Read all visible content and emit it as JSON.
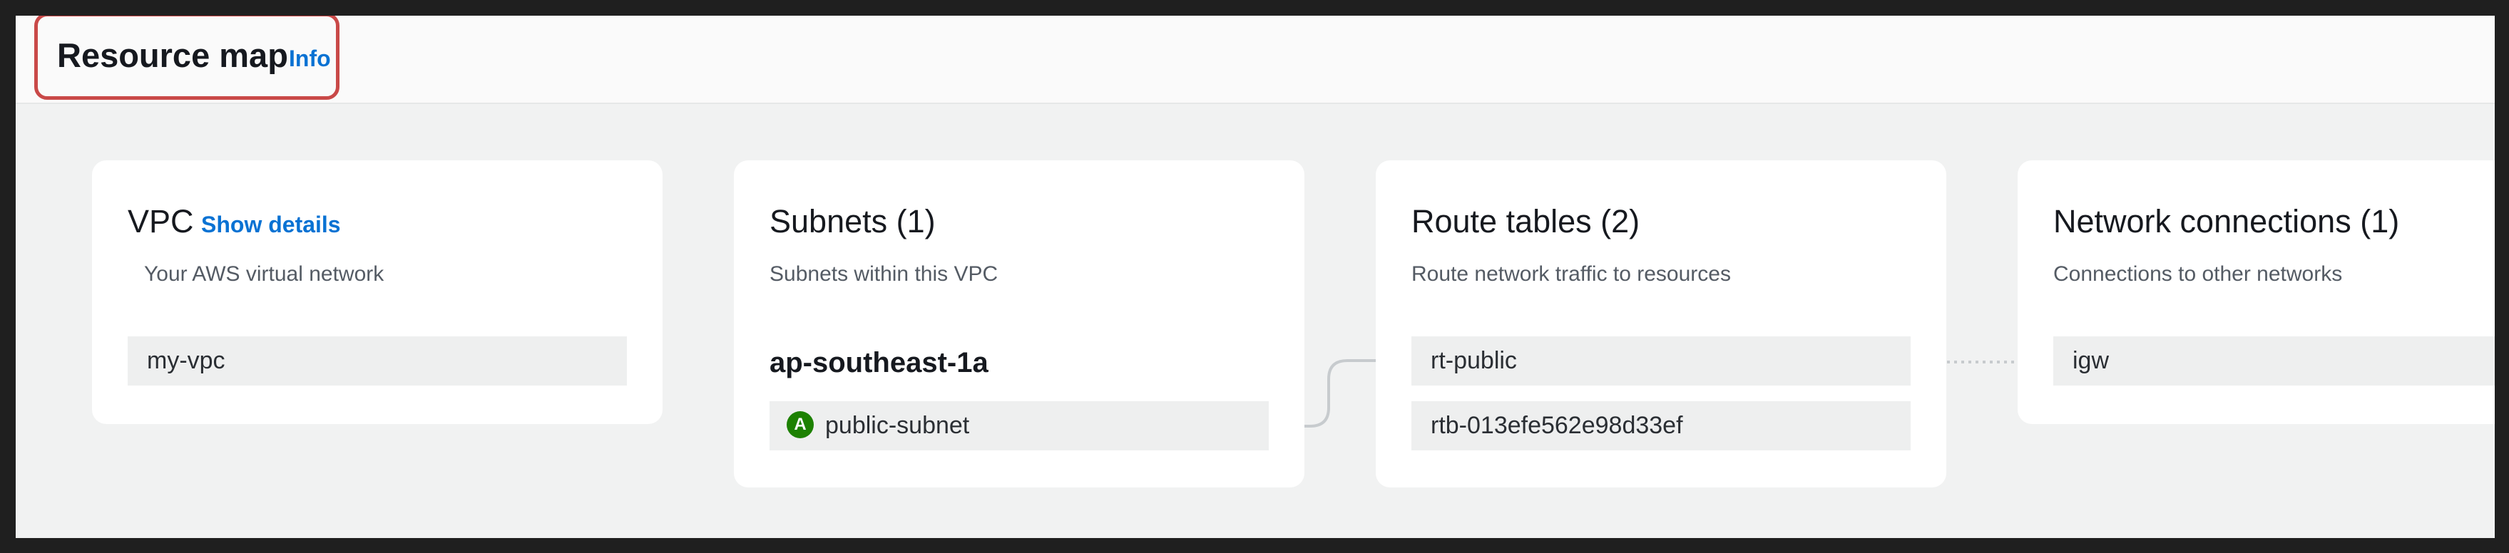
{
  "header": {
    "title": "Resource map",
    "info_link": "Info"
  },
  "vpc": {
    "title": "VPC",
    "show_details_link": "Show details",
    "subtitle": "Your AWS virtual network",
    "items": [
      "my-vpc"
    ]
  },
  "subnets": {
    "title": "Subnets (1)",
    "subtitle": "Subnets within this VPC",
    "availability_zone": "ap-southeast-1a",
    "items": [
      {
        "status_letter": "A",
        "name": "public-subnet"
      }
    ]
  },
  "route_tables": {
    "title": "Route tables (2)",
    "subtitle": "Route network traffic to resources",
    "items": [
      "rt-public",
      "rtb-013efe562e98d33ef"
    ]
  },
  "network_connections": {
    "title": "Network connections (1)",
    "subtitle": "Connections to other networks",
    "items": [
      "igw"
    ]
  },
  "colors": {
    "accent_link": "#0972d3",
    "highlight_border": "#c94948",
    "status_available": "#1d8102"
  }
}
